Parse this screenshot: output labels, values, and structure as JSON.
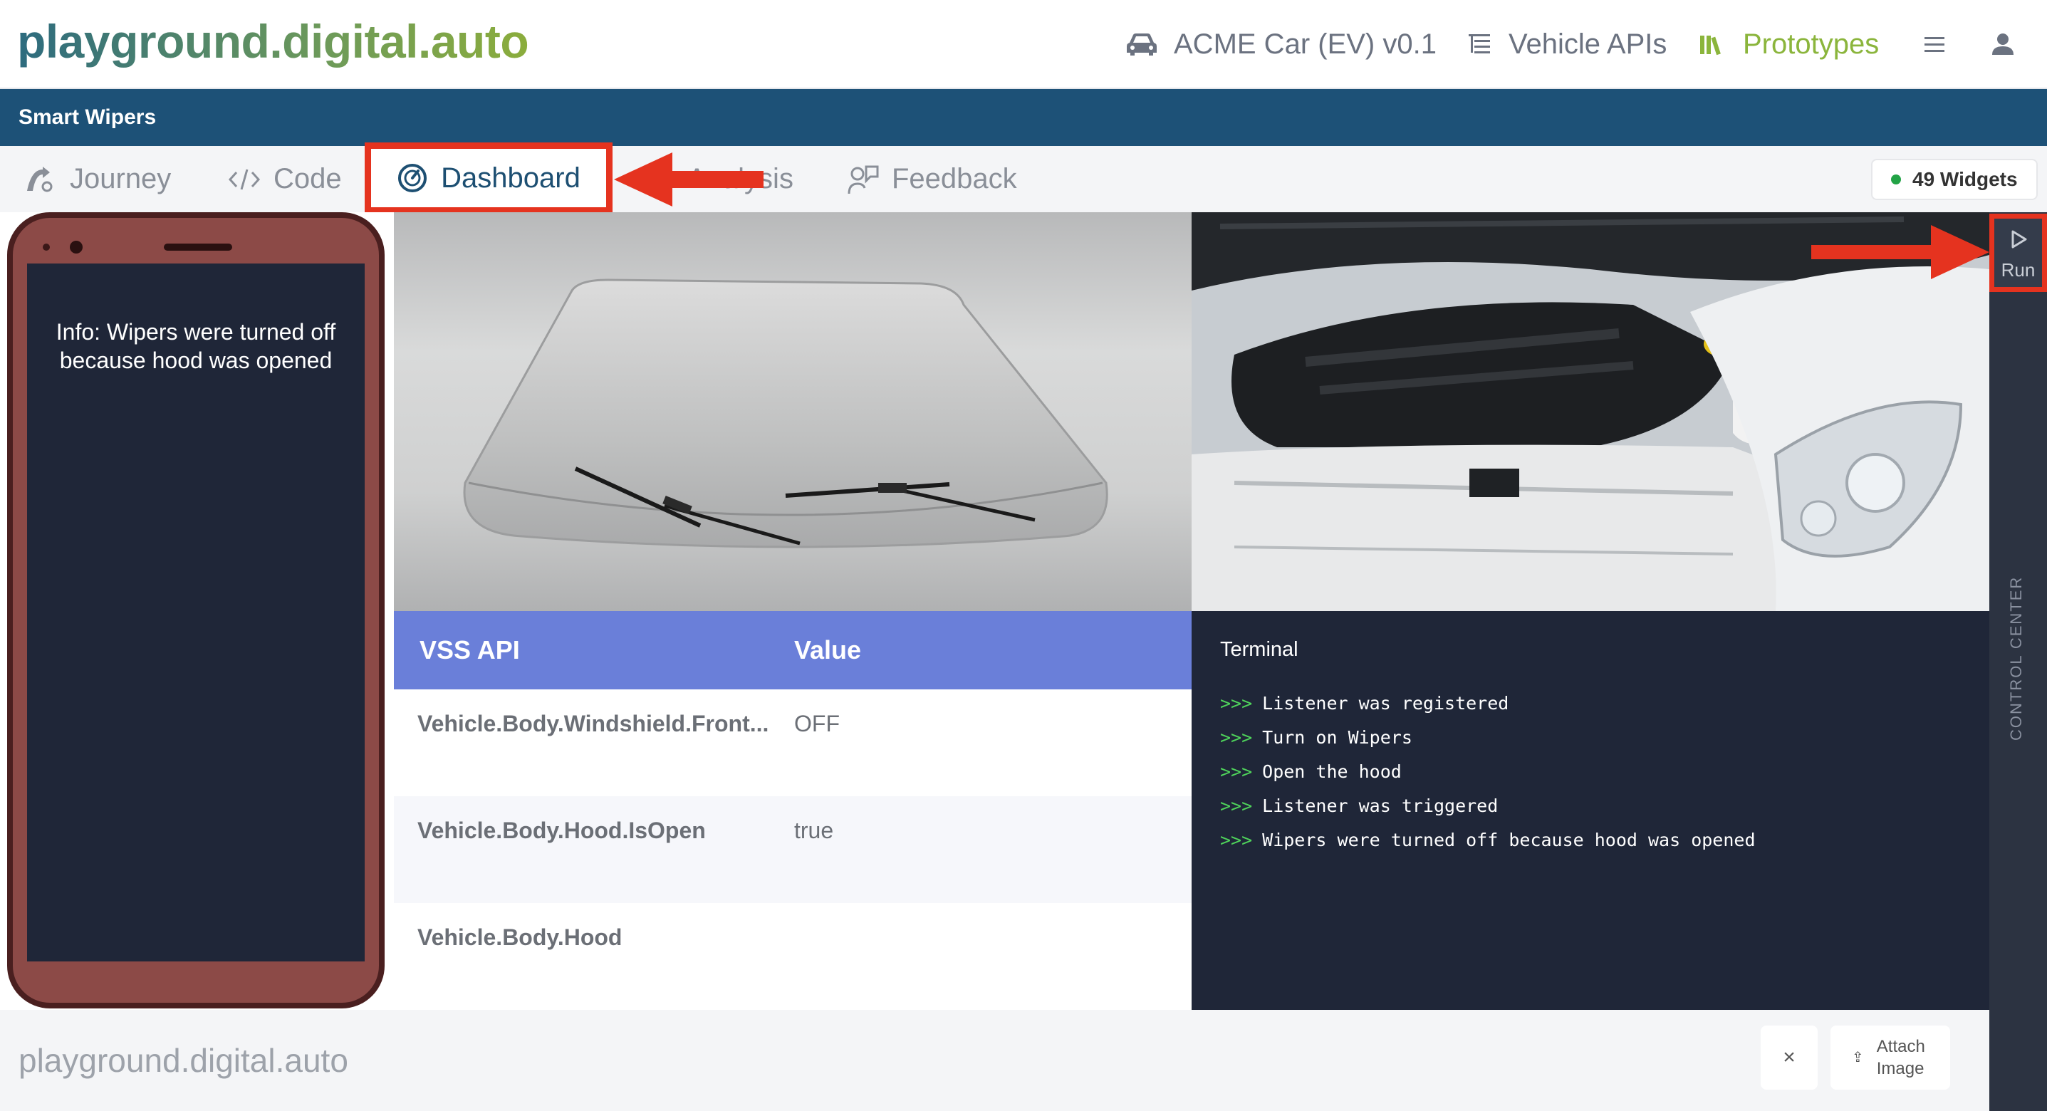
{
  "header": {
    "logo": "playground.digital.auto",
    "car_model": "ACME Car (EV) v0.1",
    "vehicle_apis": "Vehicle APIs",
    "prototypes": "Prototypes"
  },
  "prototype": {
    "title": "Smart Wipers"
  },
  "tabs": [
    {
      "label": "Journey"
    },
    {
      "label": "Code"
    },
    {
      "label": "Dashboard"
    },
    {
      "label": "Analysis"
    },
    {
      "label": "Feedback"
    }
  ],
  "widgets_badge": "49 Widgets",
  "phone": {
    "message": "Info: Wipers were turned off because hood was opened"
  },
  "vss_table": {
    "headers": [
      "VSS API",
      "Value"
    ],
    "rows": [
      {
        "api": "Vehicle.Body.Windshield.Front...",
        "value": "OFF"
      },
      {
        "api": "Vehicle.Body.Hood.IsOpen",
        "value": "true"
      },
      {
        "api": "Vehicle.Body.Hood",
        "value": ""
      }
    ]
  },
  "terminal": {
    "title": "Terminal",
    "prompt": ">>>",
    "lines": [
      "Listener was registered",
      "Turn on Wipers",
      "Open the hood",
      "Listener was triggered",
      "Wipers were turned off because hood was opened"
    ]
  },
  "control_center": {
    "run_label": "Run",
    "side_label": "CONTROL CENTER"
  },
  "footer": {
    "brand": "playground.digital.auto",
    "close": "×",
    "attach_line1": "Attach",
    "attach_line2": "Image"
  },
  "colors": {
    "brand_blue": "#1d5177",
    "accent_green": "#8bb53c",
    "highlight_red": "#e5331f",
    "table_header": "#6a7fd9",
    "terminal_bg": "#1f2638",
    "terminal_prompt": "#4fd35b"
  }
}
